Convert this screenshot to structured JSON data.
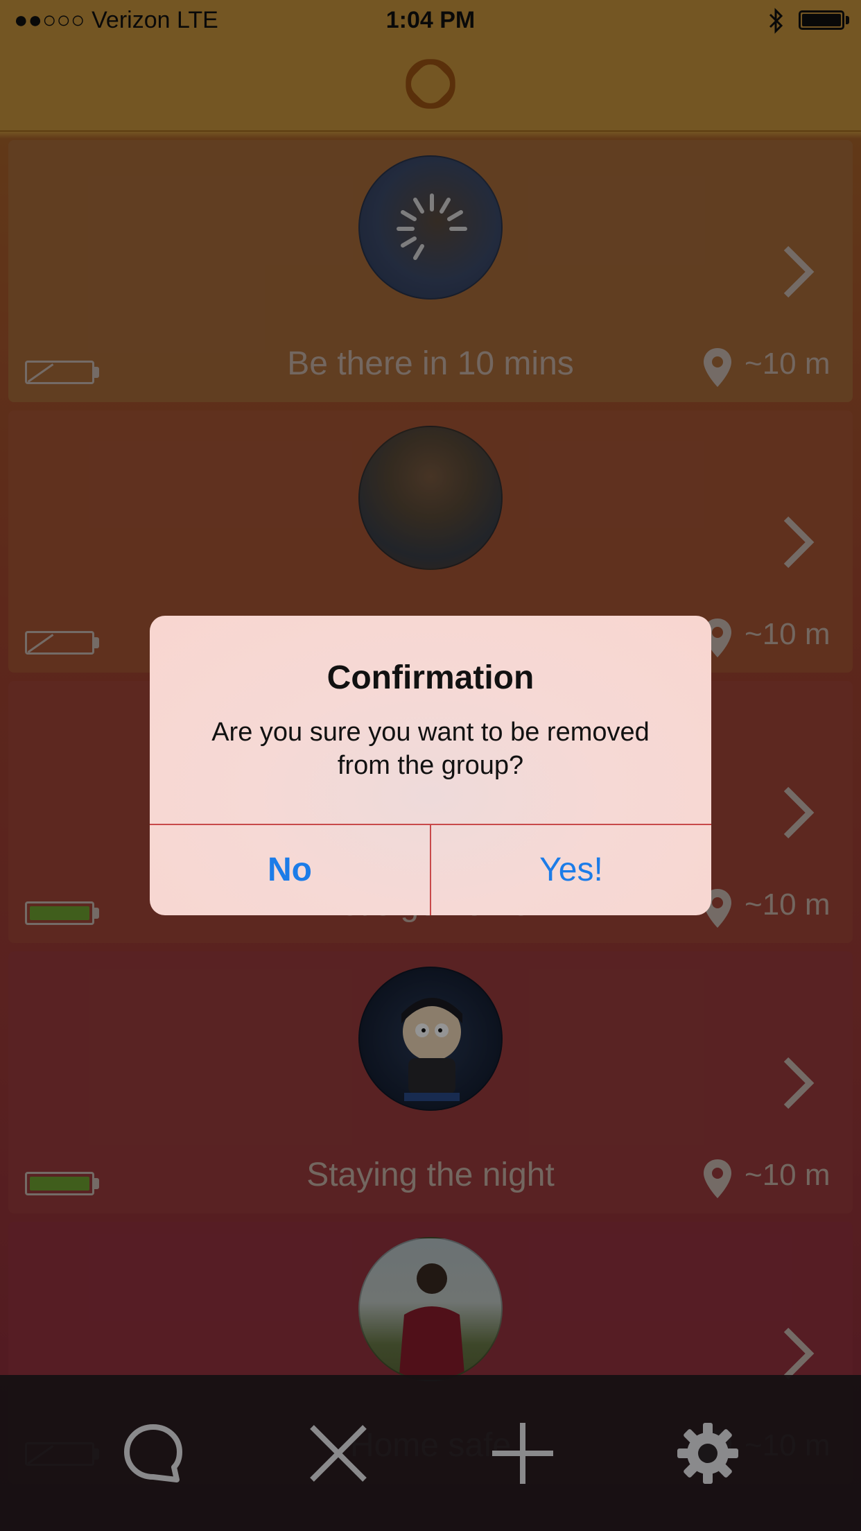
{
  "status_bar": {
    "carrier": "●●○○○ Verizon   LTE",
    "time": "1:04 PM"
  },
  "cards": [
    {
      "status": "Be there in 10 mins",
      "distance": "~10 m",
      "battery": "empty",
      "bg": "#a76b3a"
    },
    {
      "status": "",
      "distance": "~10 m",
      "battery": "empty",
      "bg": "#a65535"
    },
    {
      "status": "Let's go home!",
      "distance": "~10 m",
      "battery": "full",
      "bg": "#a04538"
    },
    {
      "status": "Staying the night",
      "distance": "~10 m",
      "battery": "full",
      "bg": "#9a3c3d"
    },
    {
      "status": "Home safe",
      "distance": "~10 m",
      "battery": "empty",
      "bg": "#95323f"
    }
  ],
  "alert": {
    "title": "Confirmation",
    "message": "Are you sure you want to be removed from the group?",
    "no_label": "No",
    "yes_label": "Yes!"
  },
  "tab_bar": {
    "icons": [
      "chat-icon",
      "close-icon",
      "add-icon",
      "settings-icon"
    ]
  },
  "colors": {
    "accent": "#1c7ce8",
    "battery_green": "#6fa331",
    "header": "#c8943d"
  }
}
